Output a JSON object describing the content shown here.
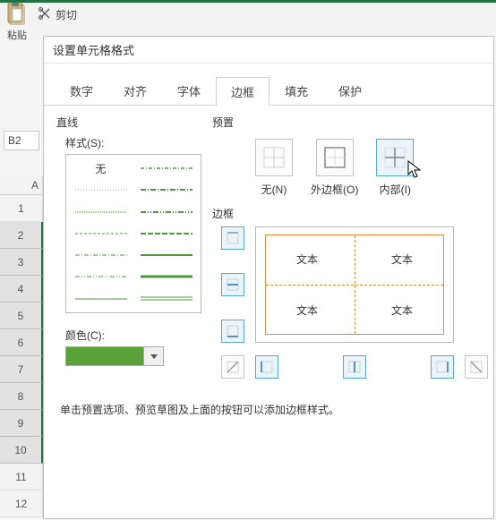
{
  "ribbon": {
    "cut_label": "剪切",
    "paste_label": "粘贴"
  },
  "namebox": {
    "value": "B2"
  },
  "sheet": {
    "col_label": "A",
    "rows": [
      "1",
      "2",
      "3",
      "4",
      "5",
      "6",
      "7",
      "8",
      "9",
      "10",
      "11",
      "12"
    ]
  },
  "dialog": {
    "title": "设置单元格格式",
    "tabs": {
      "number": "数字",
      "alignment": "对齐",
      "font": "字体",
      "border": "边框",
      "fill": "填充",
      "protect": "保护"
    },
    "line_section": "直线",
    "style_label": "样式(S):",
    "style_none": "无",
    "color_label": "颜色(C):",
    "color_value": "#5aa13a",
    "preset_section": "预置",
    "presets": {
      "none": "无(N)",
      "outline": "外边框(O)",
      "inside": "内部(I)"
    },
    "border_section": "边框",
    "preview_text": "文本",
    "hint": "单击预置选项、预览草图及上面的按钮可以添加边框样式。"
  }
}
